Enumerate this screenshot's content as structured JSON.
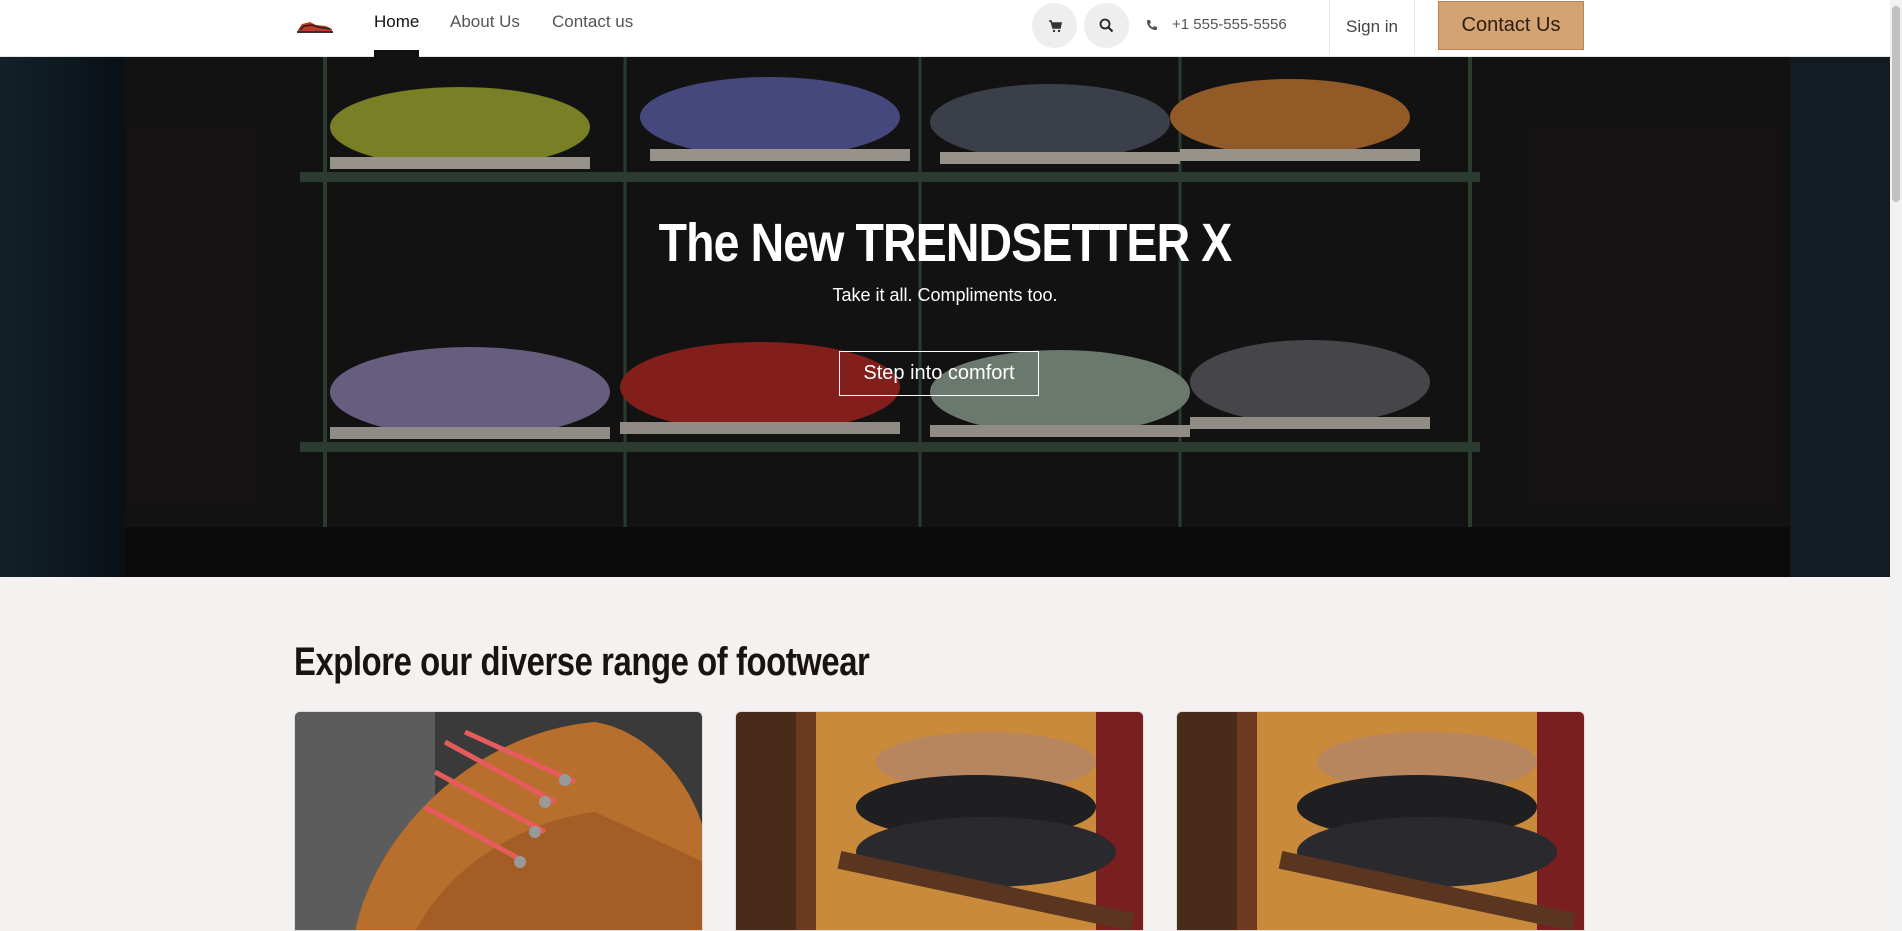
{
  "header": {
    "logo": "shoe-logo",
    "nav": [
      {
        "label": "Home",
        "active": true
      },
      {
        "label": "About Us",
        "active": false
      },
      {
        "label": "Contact us",
        "active": false
      }
    ],
    "phone": "+1 555-555-5556",
    "signin_label": "Sign in",
    "contact_label": "Contact Us"
  },
  "hero": {
    "title": "The New TRENDSETTER X",
    "subtitle": "Take it all. Compliments too.",
    "cta_label": "Step into comfort"
  },
  "section": {
    "title": "Explore our diverse range of footwear"
  },
  "colors": {
    "accent": "#d4a373",
    "text_dark": "#1a1410",
    "section_bg": "#f5f1f1"
  }
}
